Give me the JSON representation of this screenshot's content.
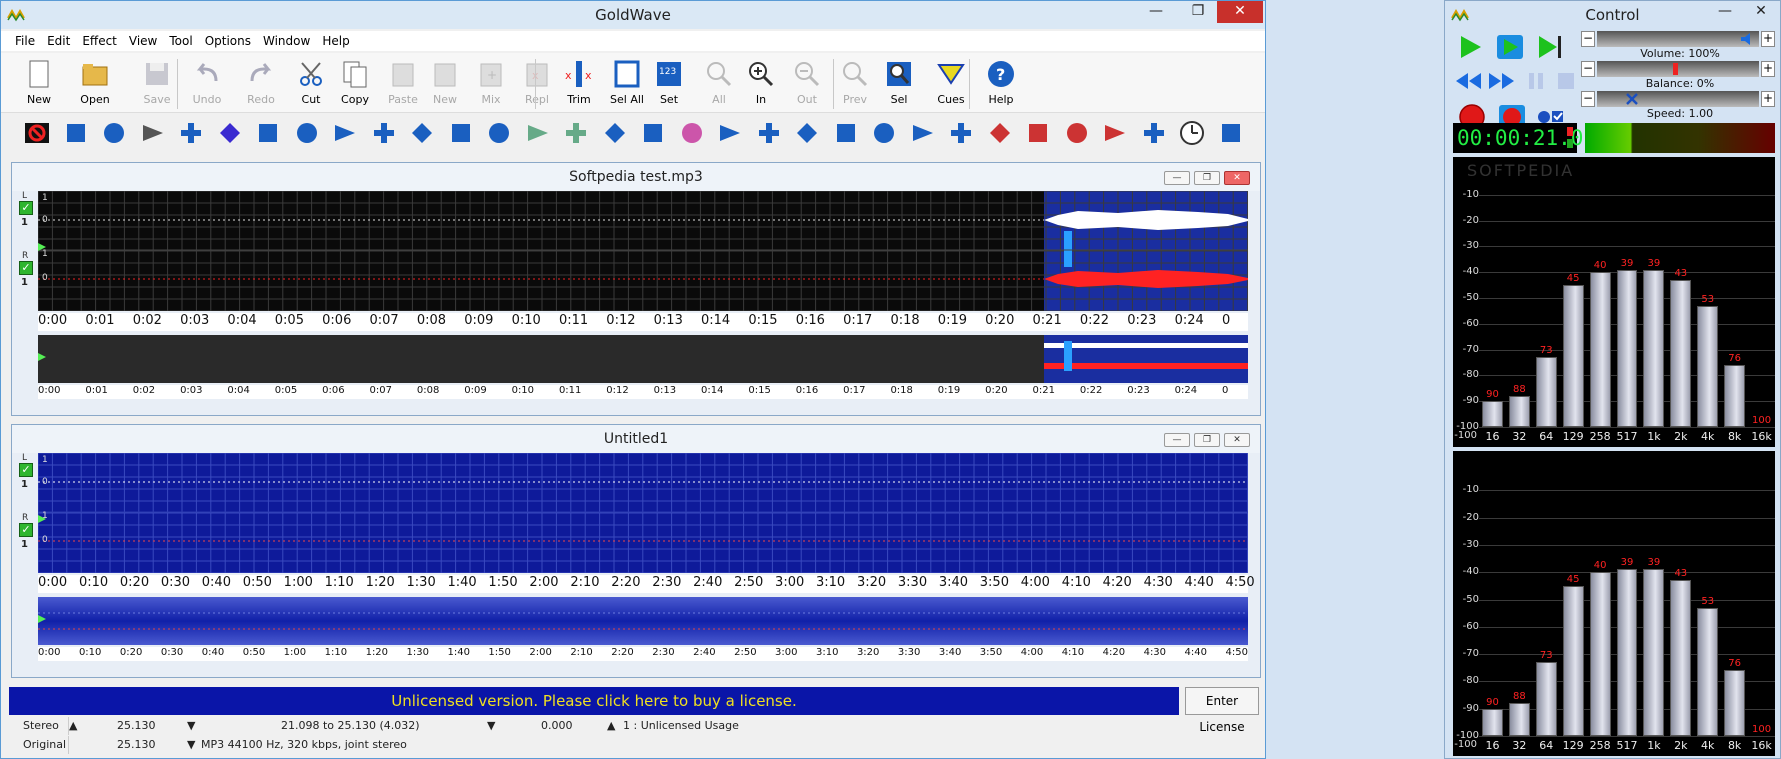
{
  "main": {
    "title": "GoldWave",
    "menu": [
      "File",
      "Edit",
      "Effect",
      "View",
      "Tool",
      "Options",
      "Window",
      "Help"
    ],
    "toolbar": [
      {
        "label": "New",
        "icon": "new-file-icon",
        "enabled": true
      },
      {
        "label": "Open",
        "icon": "open-folder-icon",
        "enabled": true
      },
      {
        "label": "Save",
        "icon": "save-icon",
        "enabled": false
      },
      {
        "label": "Undo",
        "icon": "undo-icon",
        "enabled": false
      },
      {
        "label": "Redo",
        "icon": "redo-icon",
        "enabled": false
      },
      {
        "label": "Cut",
        "icon": "cut-icon",
        "enabled": true
      },
      {
        "label": "Copy",
        "icon": "copy-icon",
        "enabled": true
      },
      {
        "label": "Paste",
        "icon": "paste-icon",
        "enabled": false
      },
      {
        "label": "New",
        "icon": "paste-new-icon",
        "enabled": false
      },
      {
        "label": "Mix",
        "icon": "mix-icon",
        "enabled": false
      },
      {
        "label": "Repl",
        "icon": "replace-icon",
        "enabled": false
      },
      {
        "label": "Trim",
        "icon": "trim-icon",
        "enabled": true
      },
      {
        "label": "Sel All",
        "icon": "select-all-icon",
        "enabled": true
      },
      {
        "label": "Set",
        "icon": "set-selection-icon",
        "enabled": true
      },
      {
        "label": "All",
        "icon": "zoom-all-icon",
        "enabled": false
      },
      {
        "label": "In",
        "icon": "zoom-in-icon",
        "enabled": true
      },
      {
        "label": "Out",
        "icon": "zoom-out-icon",
        "enabled": false
      },
      {
        "label": "Prev",
        "icon": "zoom-previous-icon",
        "enabled": false
      },
      {
        "label": "Sel",
        "icon": "zoom-selection-icon",
        "enabled": true
      },
      {
        "label": "Cues",
        "icon": "cues-icon",
        "enabled": true
      },
      {
        "label": "Help",
        "icon": "help-icon",
        "enabled": true
      }
    ],
    "effects_toolbar": [
      "stop-effect-icon",
      "maximize-icon",
      "globe-icon",
      "tools-icon",
      "forward-effect-icon",
      "wave-icon",
      "loop-icon",
      "gear-icon",
      "equalizer-icon",
      "arrow-right-icon",
      "arrow-left-icon",
      "resize-icon",
      "sliders-icon",
      "spectrum-icon",
      "spectrum-filter-icon",
      "split-icon",
      "compressor-icon",
      "color-spectrum-icon",
      "speaker-icon",
      "balance-icon",
      "ramp-up-icon",
      "ramp-down-icon",
      "channel-icon",
      "alert-icon",
      "volume-icon",
      "marker-icon",
      "no-entry-icon",
      "red-tag-icon",
      "red-tag-alt-icon",
      "blue-tag-icon",
      "clock-icon",
      "edit-icon"
    ]
  },
  "docs": [
    {
      "title": "Softpedia test.mp3",
      "channels": [
        "L",
        "R"
      ],
      "scale": [
        "1",
        "0",
        "1",
        "0"
      ],
      "ticks": [
        "0:00",
        "0:01",
        "0:02",
        "0:03",
        "0:04",
        "0:05",
        "0:06",
        "0:07",
        "0:08",
        "0:09",
        "0:10",
        "0:11",
        "0:12",
        "0:13",
        "0:14",
        "0:15",
        "0:16",
        "0:17",
        "0:18",
        "0:19",
        "0:20",
        "0:21",
        "0:22",
        "0:23",
        "0:24",
        "0"
      ],
      "selection_start": 21.098,
      "selection_end": 25.13,
      "total": 25.13
    },
    {
      "title": "Untitled1",
      "channels": [
        "L",
        "R"
      ],
      "scale": [
        "1",
        "0",
        "1",
        "0"
      ],
      "ticks": [
        "0:00",
        "0:10",
        "0:20",
        "0:30",
        "0:40",
        "0:50",
        "1:00",
        "1:10",
        "1:20",
        "1:30",
        "1:40",
        "1:50",
        "2:00",
        "2:10",
        "2:20",
        "2:30",
        "2:40",
        "2:50",
        "3:00",
        "3:10",
        "3:20",
        "3:30",
        "3:40",
        "3:50",
        "4:00",
        "4:10",
        "4:20",
        "4:30",
        "4:40",
        "4:50"
      ]
    }
  ],
  "license": {
    "message": "Unlicensed version. Please click here to buy a license.",
    "button": "Enter License"
  },
  "status": {
    "row1": {
      "mode": "Stereo",
      "length": "25.130",
      "selection": "21.098 to 25.130 (4.032)",
      "position": "0.000",
      "note": "1 : Unlicensed Usage"
    },
    "row2": {
      "mode": "Original",
      "length": "25.130",
      "format": "MP3 44100 Hz, 320 kbps, joint stereo"
    }
  },
  "control": {
    "title": "Control",
    "volume": "Volume: 100%",
    "balance": "Balance: 0%",
    "speed": "Speed: 1.00",
    "time": "00:00:21.0",
    "watermark": "SOFTPEDIA",
    "spectrum": {
      "type": "bar",
      "categories": [
        "16",
        "32",
        "64",
        "129",
        "258",
        "517",
        "1k",
        "2k",
        "4k",
        "8k",
        "16k"
      ],
      "values": [
        -90,
        -88,
        -73,
        -45,
        -40,
        -39,
        -39,
        -43,
        -53,
        -76,
        -100
      ],
      "labels": [
        "90",
        "88",
        "73",
        "45",
        "40",
        "39",
        "39",
        "43",
        "53",
        "76",
        "100"
      ],
      "yticks": [
        "-10",
        "-20",
        "-30",
        "-40",
        "-50",
        "-60",
        "-70",
        "-80",
        "-90",
        "-100"
      ],
      "ylim": [
        -100,
        0
      ],
      "colors": {
        "bar": "#d0d2dc",
        "value_label": "#ff2222",
        "background": "#000000"
      }
    }
  }
}
